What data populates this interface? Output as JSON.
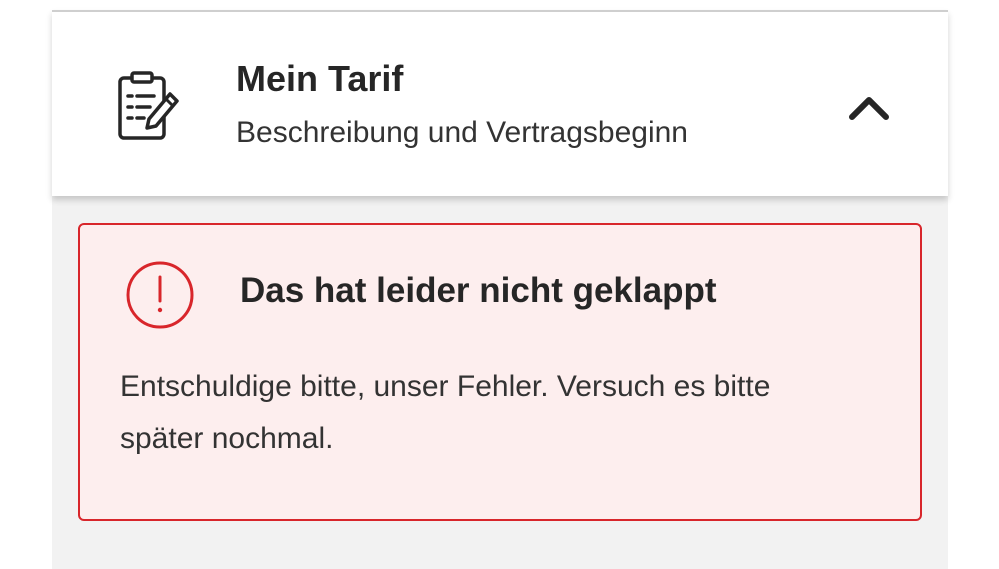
{
  "tariff_section": {
    "title": "Mein Tarif",
    "subtitle": "Beschreibung und Vertragsbeginn",
    "icon": "contract-edit-icon",
    "toggle_icon": "chevron-up-icon",
    "expanded": true
  },
  "error": {
    "title": "Das hat leider nicht geklappt",
    "message": "Entschuldige bitte, unser Fehler. Versuch es bitte später nochmal.",
    "icon": "alert-circle-icon",
    "accent_color": "#d8262b",
    "background_color": "#fdeeee"
  }
}
